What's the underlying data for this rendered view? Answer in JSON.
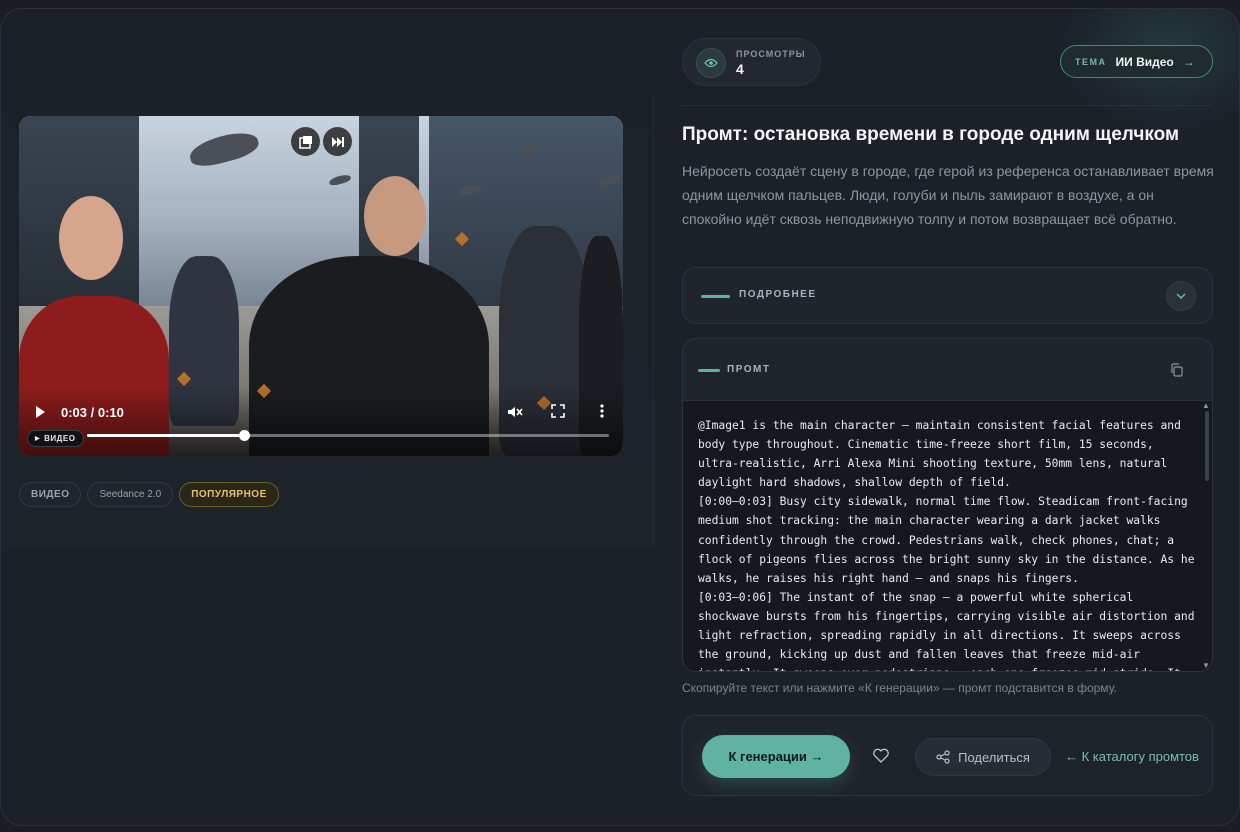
{
  "stats": {
    "views_label": "ПРОСМОТРЫ",
    "views_count": "4"
  },
  "theme": {
    "label": "ТЕМА",
    "value": "ИИ Видео",
    "arrow": "→"
  },
  "title": "Промт: остановка времени в городе одним щелчком",
  "description": "Нейросеть создаёт сцену в городе, где герой из референса останавливает время одним щелчком пальцев. Люди, голуби и пыль замирают в воздухе, а он спокойно идёт сквозь неподвижную толпу и потом возвращает всё обратно.",
  "video": {
    "time": "0:03 / 0:10",
    "progress": 0.3,
    "badge": "ВИДЕО"
  },
  "tags": [
    "ВИДЕО",
    "Seedance 2.0",
    "ПОПУЛЯРНОЕ"
  ],
  "details": {
    "label": "ПОДРОБНЕЕ"
  },
  "prompt": {
    "label": "ПРОМТ",
    "text": "@Image1 is the main character — maintain consistent facial features and body type throughout. Cinematic time-freeze short film, 15 seconds, ultra-realistic, Arri Alexa Mini shooting texture, 50mm lens, natural daylight hard shadows, shallow depth of field.\n[0:00–0:03] Busy city sidewalk, normal time flow. Steadicam front-facing medium shot tracking: the main character wearing a dark jacket walks confidently through the crowd. Pedestrians walk, check phones, chat; a flock of pigeons flies across the bright sunny sky in the distance. As he walks, he raises his right hand — and snaps his fingers.\n[0:03–0:06] The instant of the snap — a powerful white spherical shockwave bursts from his fingertips, carrying visible air distortion and light refraction, spreading rapidly in all directions. It sweeps across the ground, kicking up dust and fallen leaves that freeze mid-air instantly. It sweeps over pedestrians — each one freezes mid-stride. It sweeps across the"
  },
  "hint": "Скопируйте текст или нажмите «К генерации» — промт подставится в форму.",
  "actions": {
    "generate": "К генерации →",
    "share": "Поделиться",
    "back": "← К каталогу промтов"
  },
  "colors": {
    "accent": "#5fb3a0",
    "popular": "#e6c26a",
    "background": "#1c2128"
  }
}
